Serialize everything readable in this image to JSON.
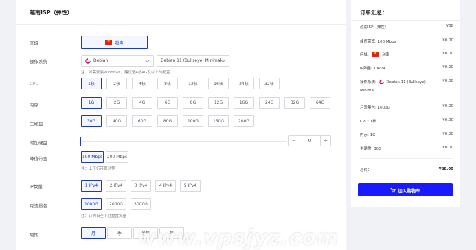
{
  "main": {
    "title": "越南ISP（弹性）",
    "region": {
      "label": "区域",
      "selected": "越南"
    },
    "os": {
      "label": "操作系统",
      "distro": "Debian",
      "version": "Debian 11 (Bullseye) Minimal",
      "note": "注：如需安装Windows，建议选4核4G及以上的配置"
    },
    "cpu": {
      "label": "CPU",
      "options": [
        "1核",
        "2核",
        "4核",
        "8核",
        "12核",
        "16核",
        "24核",
        "32核"
      ],
      "selected_index": 0
    },
    "memory": {
      "label": "内存",
      "options": [
        "1G",
        "2G",
        "4G",
        "6G",
        "8G",
        "12G",
        "16G",
        "24G",
        "32G",
        "64G"
      ],
      "selected_index": 0
    },
    "disk": {
      "label": "主硬盘",
      "options": [
        "30G",
        "40G",
        "60G",
        "80G",
        "100G",
        "150G",
        "200G"
      ],
      "selected_index": 0
    },
    "extra_disk": {
      "label": "附加硬盘",
      "value": "0",
      "minus": "−",
      "plus": "+"
    },
    "bandwidth": {
      "label": "峰值带宽",
      "options": [
        "100 Mbps",
        "200 Mbps"
      ],
      "selected_index": 0,
      "note": "注：上下行带宽对等"
    },
    "ip": {
      "label": "IP数量",
      "options": [
        "1 IPv4",
        "2 IPv4",
        "3 IPv4",
        "4 IPv4",
        "5 IPv4"
      ],
      "selected_index": 0
    },
    "traffic": {
      "label": "月流量包",
      "options": [
        "1000G",
        "2000G",
        "3000G"
      ],
      "selected_index": 0,
      "note": "注：订购日至下月重置流量"
    },
    "period": {
      "label": "周期",
      "options": [
        "月",
        "季",
        "半年",
        "年"
      ],
      "selected_index": 0
    }
  },
  "summary": {
    "title": "订单汇总：",
    "rows": [
      {
        "label": "越南ISP（弹性）:",
        "value": "¥88"
      },
      {
        "label": "峰值带宽: 100 Mbps",
        "value": "¥0.00"
      },
      {
        "label": "区域:",
        "extra": "越南",
        "value": "¥0.00"
      },
      {
        "label": "IP数量: 1 IPv4",
        "value": "¥0.00"
      },
      {
        "label": "操作系统:",
        "extra": "Debian 11 (Bullseye)",
        "extra2": "Minimal",
        "value": "¥0.00"
      },
      {
        "label": "月流量包: 1000G",
        "value": "¥0.00"
      },
      {
        "label": "CPU: 1核",
        "value": "¥0.00"
      },
      {
        "label": "内存: 1G",
        "value": "¥0.00"
      },
      {
        "label": "主硬盘: 30G",
        "value": "¥0.00"
      }
    ],
    "total_label": "总价：",
    "total_value": "¥88.00",
    "cart_button": "加入购物车"
  },
  "watermark": "www.vpsjyz.com",
  "colors": {
    "accent": "#1d39c4",
    "button": "#1a1aff",
    "flag": "#da251d"
  }
}
